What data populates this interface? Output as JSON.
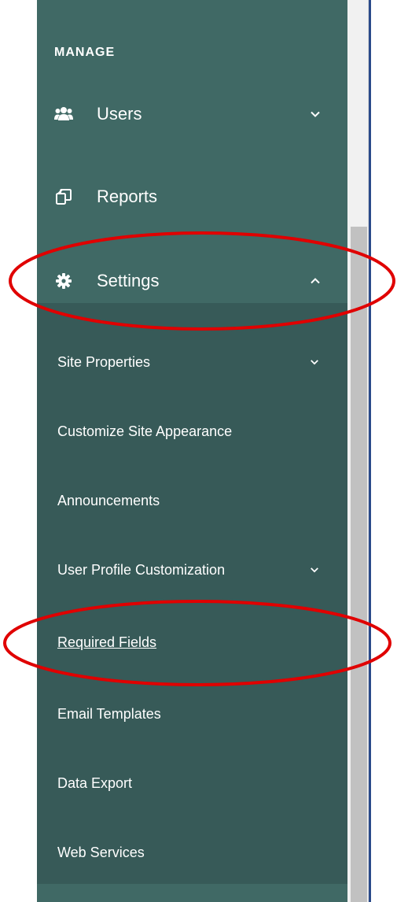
{
  "sidebar": {
    "section_label": "MANAGE",
    "nav": {
      "users": {
        "label": "Users",
        "icon": "users-icon",
        "chevron": "chevron-down-icon"
      },
      "reports": {
        "label": "Reports",
        "icon": "reports-icon"
      },
      "settings": {
        "label": "Settings",
        "icon": "gear-icon",
        "chevron": "chevron-up-icon",
        "expanded": true
      }
    },
    "settings_submenu": [
      {
        "label": "Site Properties",
        "has_chevron": true
      },
      {
        "label": "Customize Site Appearance",
        "has_chevron": false
      },
      {
        "label": "Announcements",
        "has_chevron": false
      },
      {
        "label": "User Profile Customization",
        "has_chevron": true
      },
      {
        "label": "Required Fields",
        "has_chevron": false,
        "current": true
      },
      {
        "label": "Email Templates",
        "has_chevron": false
      },
      {
        "label": "Data Export",
        "has_chevron": false
      },
      {
        "label": "Web Services",
        "has_chevron": false
      }
    ]
  },
  "colors": {
    "sidebar_bg": "#406965",
    "submenu_bg": "#375a58",
    "text": "#ffffff",
    "annotation": "#e00000",
    "scroll_track": "#f1f1f1",
    "scroll_thumb": "#c1c1c1"
  }
}
